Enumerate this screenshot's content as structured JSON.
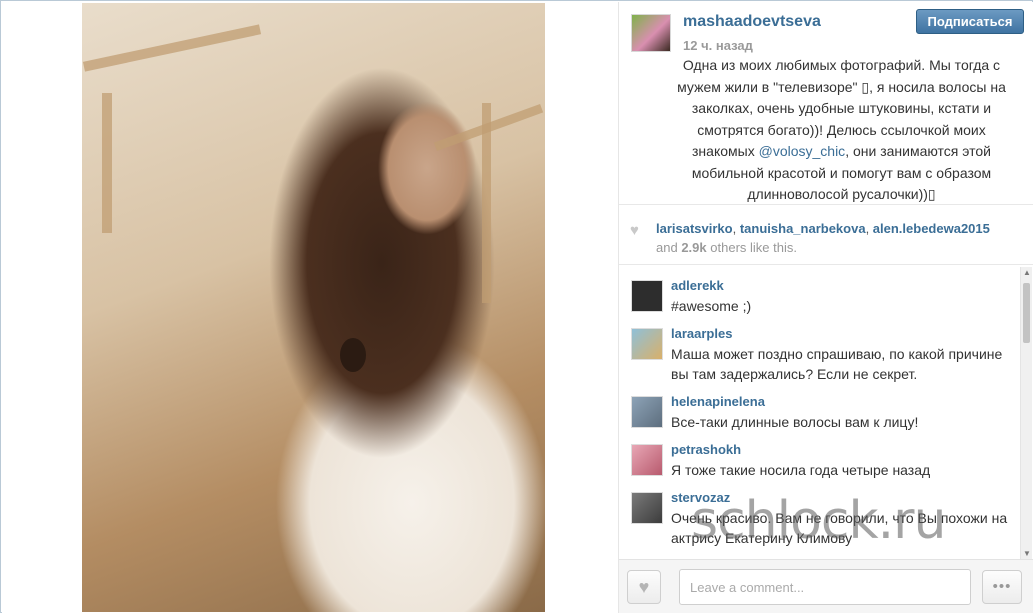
{
  "post": {
    "owner": "mashaadoevtseva",
    "time": "12 ч. назад",
    "follow_label": "Подписаться",
    "caption_before": "Одна из моих любимых фотографий. Мы тогда с мужем жили в \"телевизоре\" ▯, я носила волосы на заколках, очень удобные штуковины, кстати и смотрятся богато))! Делюсь ссылочкой моих знакомых ",
    "caption_mention": "@volosy_chic",
    "caption_after": ", они занимаются этой мобильной красотой и помогут вам с образом длинноволосой русалочки))▯"
  },
  "likes": {
    "users": [
      "larisatsvirko",
      "tanuisha_narbekova",
      "alen.lebedewa2015"
    ],
    "and_label": "and",
    "count": "2.9k",
    "rest_label": "others like this."
  },
  "comments": [
    {
      "user": "adlerekk",
      "text": "#awesome ;)",
      "avatar_color": "#2d2d2d"
    },
    {
      "user": "laraarples",
      "text": "Маша может поздно спрашиваю, по какой причине вы там задержались? Если не секрет.",
      "avatar_color": "#d9b06a"
    },
    {
      "user": "helenapinelena",
      "text": "Все-таки длинные волосы вам к лицу!",
      "avatar_color": "#5d6e7e"
    },
    {
      "user": "petrashokh",
      "text": "Я тоже такие носила года четыре назад",
      "avatar_color": "#b85a6e"
    },
    {
      "user": "stervozaz",
      "text": "Очень красиво. Вам не говорили, что Вы похожи на актрису Екатерину Климову",
      "avatar_color": "#3c3c3c"
    }
  ],
  "footer": {
    "comment_placeholder": "Leave a comment...",
    "more_label": "•••"
  },
  "watermark": "schlock.ru",
  "colors": {
    "link": "#3b6e96",
    "follow_button": "#4b7fae"
  },
  "icons": {
    "like": "heart-icon",
    "more": "ellipsis-icon"
  }
}
